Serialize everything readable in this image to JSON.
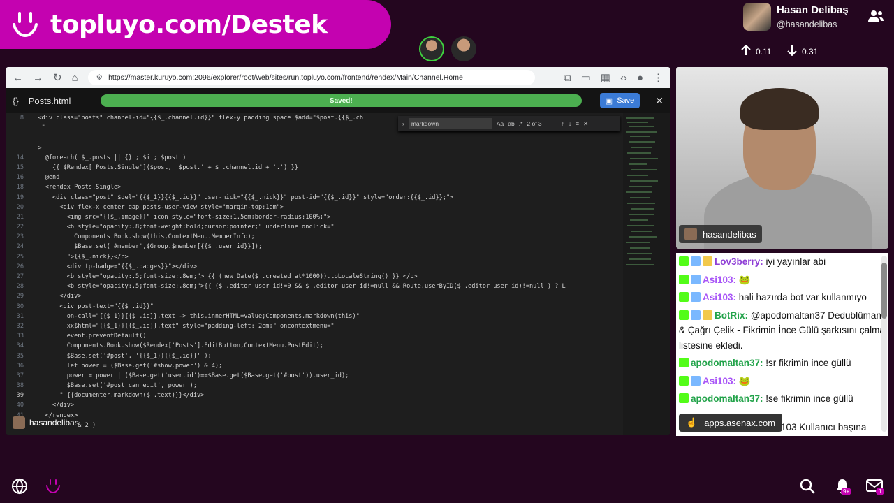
{
  "banner": {
    "title": "topluyo.com/Destek"
  },
  "profile": {
    "name": "Hasan Delibaş",
    "handle": "@hasandelibas",
    "upload": "0.11",
    "download": "0.31"
  },
  "browser": {
    "url": "https://master.kuruyo.com:2096/explorer/root/web/sites/run.topluyo.com/frontend/rendex/Main/Channel.Home"
  },
  "editor_toolbar": {
    "filename": "Posts.html",
    "status": "Saved!",
    "save_label": "Save"
  },
  "find": {
    "query": "markdown",
    "count": "2 of 3"
  },
  "code_lines": [
    {
      "n": "8",
      "t": "  <div class=\"posts\" channel-id=\"{{$_.channel.id}}\" flex-y padding space $add=\"$post.{{$_.ch"
    },
    {
      "n": "",
      "t": "   \""
    },
    {
      "n": "",
      "t": ""
    },
    {
      "n": "",
      "t": "  >"
    },
    {
      "n": "14",
      "t": "    @foreach( $_.posts || {} ; $i ; $post )"
    },
    {
      "n": "15",
      "t": "      {{ $Rendex['Posts.Single']($post, '$post.' + $_.channel.id + '.') }}"
    },
    {
      "n": "16",
      "t": "    @end"
    },
    {
      "n": "18",
      "t": "    <rendex Posts.Single>"
    },
    {
      "n": "19",
      "t": "      <div class=\"post\" $del=\"{{$_1}}{{$_.id}}\" user-nick=\"{{$_.nick}}\" post-id=\"{{$_.id}}\" style=\"order:{{$_.id}};\">"
    },
    {
      "n": "20",
      "t": "        <div flex-x center gap posts-user-view style=\"margin-top:1em\">"
    },
    {
      "n": "21",
      "t": "          <img src=\"{{$_.image}}\" icon style=\"font-size:1.5em;border-radius:100%;\">"
    },
    {
      "n": "22",
      "t": "          <b style=\"opacity:.8;font-weight:bold;cursor:pointer;\" underline onclick=\""
    },
    {
      "n": "23",
      "t": "            Components.Book.show(this,ContextMenu.MemberInfo);"
    },
    {
      "n": "24",
      "t": "            $Base.set('#member',$Group.$member[{{$_.user_id}}]);"
    },
    {
      "n": "25",
      "t": "          \">{{$_.nick}}</b>"
    },
    {
      "n": "26",
      "t": "          <div tp-badge=\"{{$_.badges}}\"></div>"
    },
    {
      "n": "27",
      "t": "          <b style=\"opacity:.5;font-size:.8em;\"> {{ (new Date($_.created_at*1000)).toLocaleString() }} </b>"
    },
    {
      "n": "28",
      "t": "          <b style=\"opacity:.5;font-size:.8em;\">{{ ($_.editor_user_id!=0 && $_.editor_user_id!=null && Route.userByID($_.editor_user_id)!=null ) ? L"
    },
    {
      "n": "29",
      "t": "        </div>"
    },
    {
      "n": "30",
      "t": "        <div post-text=\"{{$_.id}}\""
    },
    {
      "n": "31",
      "t": "          on-call=\"{{$_1}}{{$_.id}}.text -> this.innerHTML=value;Components.markdown(this)\""
    },
    {
      "n": "32",
      "t": "          xx$html=\"{{$_1}}{{$_.id}}.text\" style=\"padding-left: 2em;\" oncontextmenu=\""
    },
    {
      "n": "33",
      "t": "          event.preventDefault()"
    },
    {
      "n": "34",
      "t": "          Components.Book.show($Rendex['Posts'].EditButton,ContextMenu.PostEdit);"
    },
    {
      "n": "35",
      "t": "          $Base.set('#post', '{{$_1}}{{$_.id}}' );"
    },
    {
      "n": "36",
      "t": "          let power = ($Base.get('#show.power') & 4);"
    },
    {
      "n": "37",
      "t": "          power = power | ($Base.get('user.id')==$Base.get($Base.get('#post')).user_id);"
    },
    {
      "n": "38",
      "t": "          $Base.set('#post_can_edit', power );"
    },
    {
      "n": "39",
      "t": "        \" {{documenter.markdown($_.text)}}</div>"
    },
    {
      "n": "40",
      "t": "      </div>"
    },
    {
      "n": "41",
      "t": "    </rendex>"
    },
    {
      "n": "",
      "t": "             & 2 )"
    }
  ],
  "stream_overlay": {
    "nick": "hasandelibas"
  },
  "webcam": {
    "label": "hasandelibas"
  },
  "chat": {
    "messages": [
      {
        "user": "Lov3berry:",
        "text": " iyi yayınlar abi",
        "color": "#8f3fd6",
        "badges": 3
      },
      {
        "user": "Asi103:",
        "text": " 🐸",
        "color": "#a855f7",
        "badges": 2
      },
      {
        "user": "Asi103:",
        "text": " hali hazırda bot var kullanmıyo",
        "color": "#a855f7",
        "badges": 2
      },
      {
        "user": "BotRix:",
        "text": " @apodomaltan37 Dedublüman & Çağrı Çelik - Fikrimin İnce Gülü şarkısını çalma listesine ekledi.",
        "color": "#22a34a",
        "badges": 3
      },
      {
        "user": "apodomaltan37:",
        "text": " !sr fikrimin ince güllü",
        "color": "#22a34a",
        "badges": 1
      },
      {
        "user": "Asi103:",
        "text": " 🐸",
        "color": "#a855f7",
        "badges": 2
      },
      {
        "user": "apodomaltan37:",
        "text": " !se fikrimin ince güllü",
        "color": "#22a34a",
        "badges": 1
      }
    ],
    "overlay_text": "apps.asenax.com",
    "trailing_text": "103 Kullanıcı başına"
  },
  "bottom": {
    "notif_count": "9+",
    "mail_count": "1"
  },
  "colors": {
    "banner": "#c402b0",
    "background": "#24061f",
    "save": "#3b7bd6",
    "progress": "#4caf50"
  }
}
